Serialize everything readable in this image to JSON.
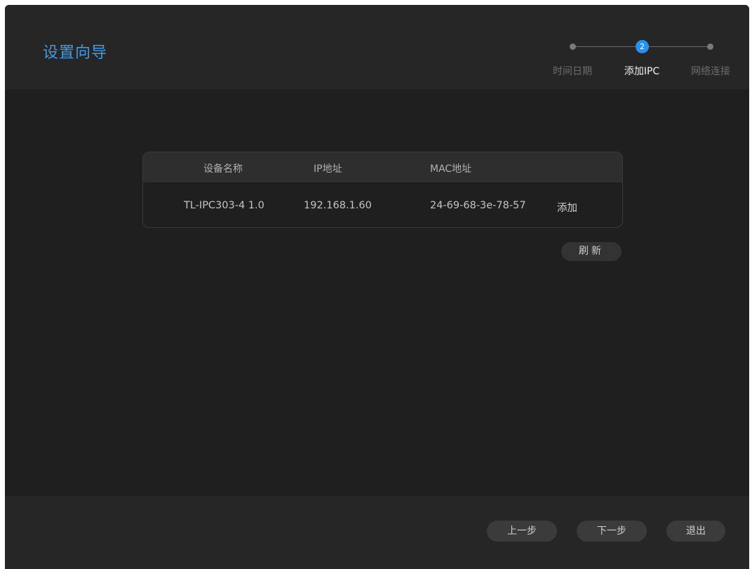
{
  "header": {
    "title": "设置向导"
  },
  "stepper": {
    "steps": [
      {
        "label": "时间日期",
        "state": "done"
      },
      {
        "label": "添加IPC",
        "state": "active",
        "number": "2"
      },
      {
        "label": "网络连接",
        "state": "pending"
      }
    ]
  },
  "table": {
    "columns": [
      "设备名称",
      "IP地址",
      "MAC地址"
    ],
    "rows": [
      {
        "name": "TL-IPC303-4 1.0",
        "ip": "192.168.1.60",
        "mac": "24-69-68-3e-78-57",
        "action": "添加"
      }
    ]
  },
  "refresh_label": "刷新",
  "footer": {
    "prev_label": "上一步",
    "next_label": "下一步",
    "exit_label": "退出"
  },
  "colors": {
    "accent": "#3f9be6",
    "step_active": "#2b8ff0",
    "background": "#1f1f1f",
    "panel": "#262626"
  }
}
